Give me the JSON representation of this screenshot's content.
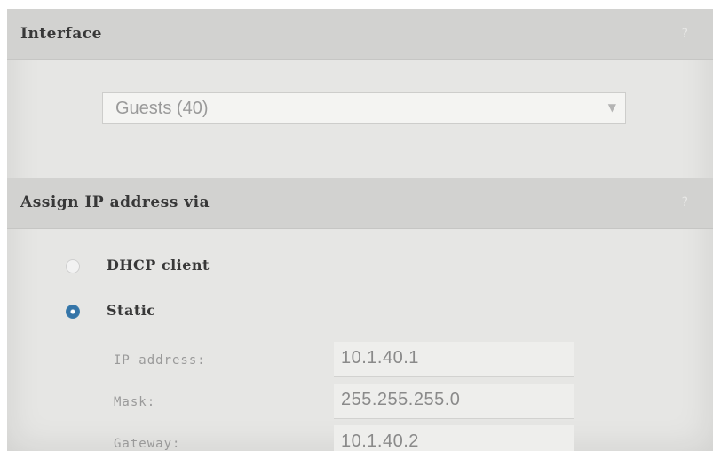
{
  "interface": {
    "title": "Interface",
    "help_icon": "?",
    "selected_interface": "Guests (40)",
    "dropdown_icon": "chevron-down-icon"
  },
  "assign": {
    "title": "Assign IP address via",
    "help_icon": "?",
    "options": [
      {
        "label": "DHCP client",
        "checked": false
      },
      {
        "label": "Static",
        "checked": true
      }
    ],
    "fields": {
      "ip_label": "IP address:",
      "ip_value": "10.1.40.1",
      "mask_label": "Mask:",
      "mask_value": "255.255.255.0",
      "gateway_label": "Gateway:",
      "gateway_value": "10.1.40.2"
    }
  },
  "colors": {
    "accent": "#4fc8ee",
    "radio_selected": "#3575a8",
    "header_bg": "#d2d2d0",
    "panel_bg": "#e6e6e4"
  }
}
